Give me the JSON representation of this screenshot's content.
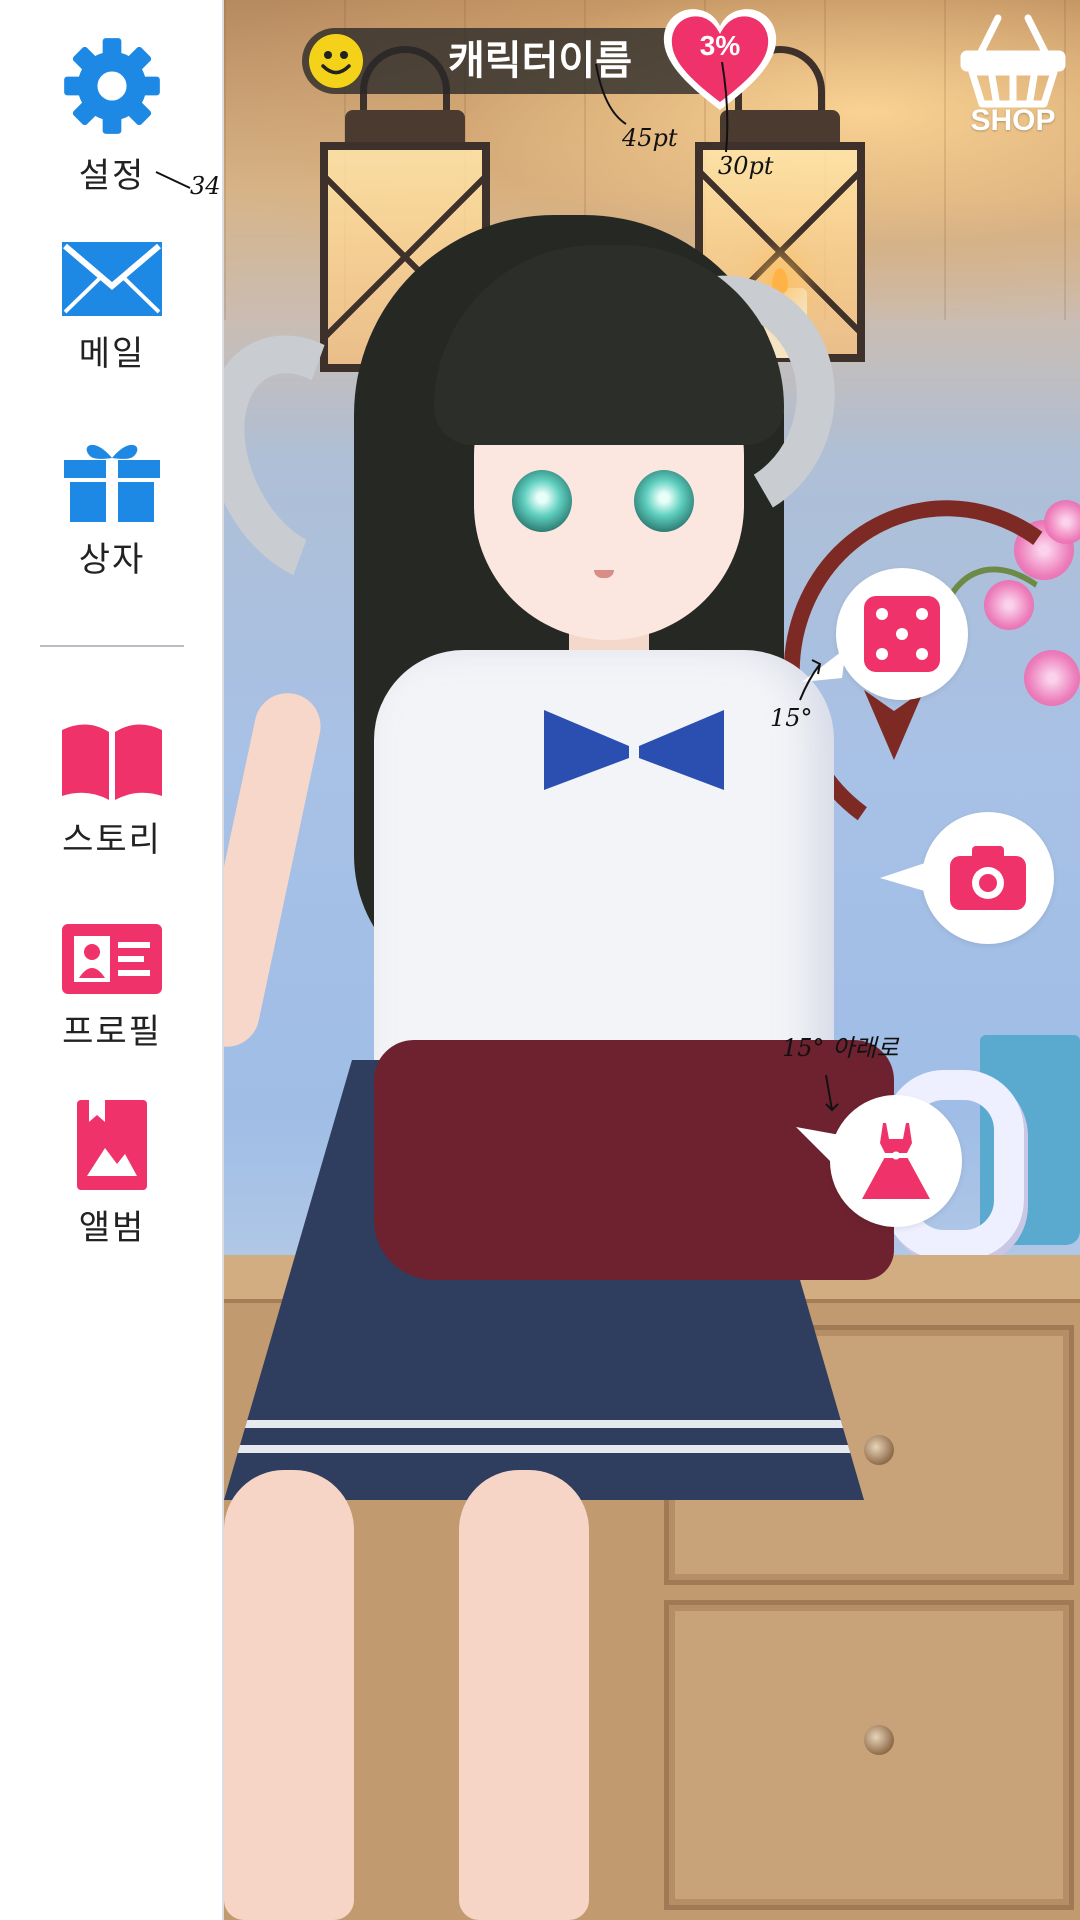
{
  "sidebar": {
    "items": [
      {
        "label": "설정",
        "icon": "gear-icon",
        "color": "#1e88e5"
      },
      {
        "label": "메일",
        "icon": "mail-icon",
        "color": "#1e88e5"
      },
      {
        "label": "상자",
        "icon": "gift-box-icon",
        "color": "#1e88e5"
      },
      {
        "label": "스토리",
        "icon": "open-book-icon",
        "color": "#f0326a"
      },
      {
        "label": "프로필",
        "icon": "profile-card-icon",
        "color": "#f0326a"
      },
      {
        "label": "앨범",
        "icon": "album-icon",
        "color": "#f0326a"
      }
    ]
  },
  "hud": {
    "character_name": "캐릭터이름",
    "mood_icon": "smiley-face-icon",
    "affection_percent": "3%",
    "affection_level": 0.03,
    "shop_label": "SHOP",
    "shop_icon": "basket-icon"
  },
  "actions": [
    {
      "name": "dice-button",
      "icon": "dice-icon"
    },
    {
      "name": "camera-button",
      "icon": "camera-icon"
    },
    {
      "name": "outfit-button",
      "icon": "dress-icon"
    }
  ],
  "annotations": {
    "settings_font": "34",
    "name_font": "45pt",
    "heart_font": "30pt",
    "dice_angle": "15°",
    "dress_angle": "15° 아래로"
  },
  "colors": {
    "accent_blue": "#1e88e5",
    "accent_pink": "#f0326a",
    "heart": "#f0326a",
    "namebar_bg": "#333333"
  }
}
